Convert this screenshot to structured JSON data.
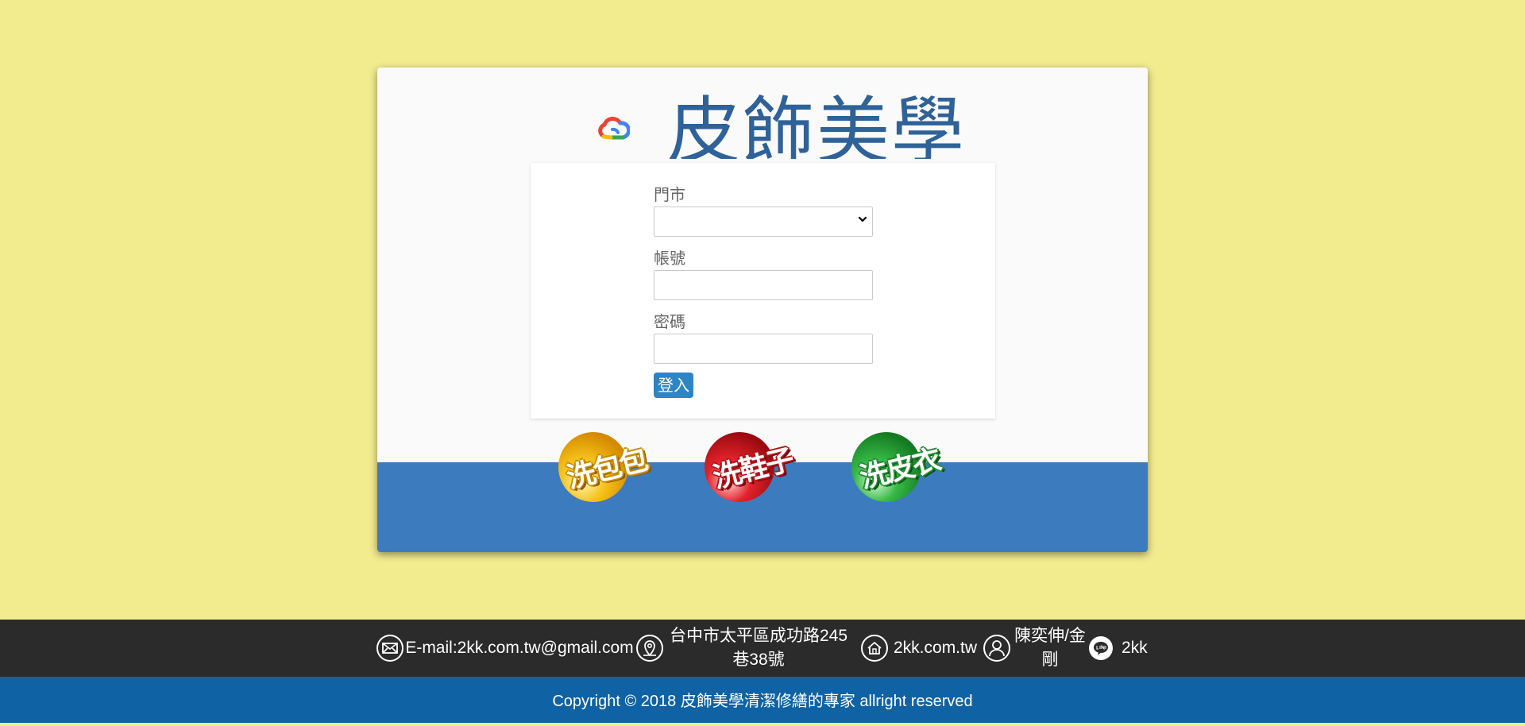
{
  "brand": {
    "title": "皮飾美學"
  },
  "form": {
    "store_label": "門市",
    "store_value": "",
    "account_label": "帳號",
    "account_value": "",
    "password_label": "密碼",
    "password_value": "",
    "login_label": "登入"
  },
  "services": [
    {
      "label": "洗包包",
      "color": "#f2b50f"
    },
    {
      "label": "洗鞋子",
      "color": "#d3121c"
    },
    {
      "label": "洗皮衣",
      "color": "#2faa3c"
    }
  ],
  "footer": {
    "email": "E-mail:2kk.com.tw@gmail.com",
    "address": "台中市太平區成功路245巷38號",
    "website": "2kk.com.tw",
    "contact": "陳奕伸/金剛",
    "line": "2kk",
    "copyright": "Copyright © 2018 皮飾美學清潔修繕的專家 allright reserved"
  },
  "colors": {
    "page_background": "#f2ec8f",
    "brand_text": "#2e6298",
    "band": "#3d7bbf",
    "button": "#2d84c7",
    "footer_dark": "#2b2b2b",
    "footer_blue": "#0f62a3"
  },
  "icons": [
    "google-cloud-icon",
    "envelope-icon",
    "map-pin-icon",
    "home-icon",
    "user-icon",
    "line-icon"
  ]
}
